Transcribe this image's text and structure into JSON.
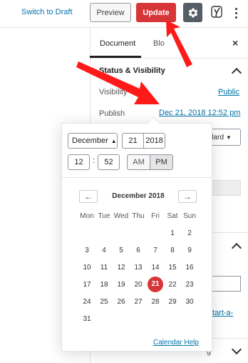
{
  "toolbar": {
    "switch_to_draft": "Switch to Draft",
    "preview": "Preview",
    "update": "Update",
    "settings_icon": "gear-icon",
    "yoast_icon": "yoast-icon",
    "more_icon": "vertical-ellipsis-icon"
  },
  "sidebar": {
    "tabs": [
      {
        "label": "Document",
        "active": true
      },
      {
        "label": "Blo",
        "active": false
      }
    ],
    "close_label": "×",
    "section_title": "Status & Visibility",
    "visibility_label": "Visibility",
    "visibility_value": "Public",
    "publish_label": "Publish",
    "publish_value": "Dec 21, 2018 12:52 pm",
    "template_value": "dard",
    "link_fragment": "tart-a-",
    "bottom_fragment": "g"
  },
  "datepicker": {
    "month_value": "December",
    "day_value": "21",
    "year_value": "2018",
    "hour_value": "12",
    "minute_value": "52",
    "am_label": "AM",
    "pm_label": "PM",
    "pm_selected": true,
    "prev_arrow": "←",
    "next_arrow": "→",
    "month_title": "December 2018",
    "weekdays": [
      "Mon",
      "Tue",
      "Wed",
      "Thu",
      "Fri",
      "Sat",
      "Sun"
    ],
    "weeks": [
      [
        "",
        "",
        "",
        "",
        "",
        "1",
        "2"
      ],
      [
        "3",
        "4",
        "5",
        "6",
        "7",
        "8",
        "9"
      ],
      [
        "10",
        "11",
        "12",
        "13",
        "14",
        "15",
        "16"
      ],
      [
        "17",
        "18",
        "19",
        "20",
        "21",
        "22",
        "23"
      ],
      [
        "24",
        "25",
        "26",
        "27",
        "28",
        "29",
        "30"
      ],
      [
        "31",
        "",
        "",
        "",
        "",
        "",
        ""
      ]
    ],
    "selected_day": "21",
    "calendar_help": "Calendar Help"
  },
  "colors": {
    "accent_red": "#d63638",
    "link_blue": "#0073aa",
    "arrow_red": "#ff1a1a"
  }
}
